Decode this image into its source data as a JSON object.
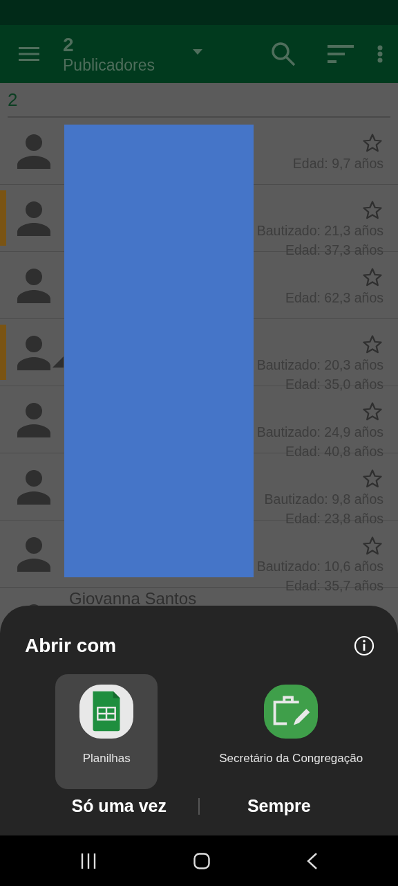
{
  "toolbar": {
    "count": "2",
    "title": "Publicadores"
  },
  "section": {
    "header": "2"
  },
  "rows": [
    {
      "name": "",
      "baptized": "",
      "age": "Edad: 9,7 años",
      "marked": false,
      "badge": false,
      "starred": false
    },
    {
      "name": "",
      "baptized": "Bautizado: 21,3 años",
      "age": "Edad: 37,3 años",
      "marked": true,
      "badge": false,
      "starred": false
    },
    {
      "name": "",
      "baptized": "",
      "age": "Edad: 62,3 años",
      "marked": false,
      "badge": false,
      "starred": false
    },
    {
      "name": "",
      "baptized": "Bautizado: 20,3 años",
      "age": "Edad: 35,0 años",
      "marked": true,
      "badge": true,
      "starred": false
    },
    {
      "name": "",
      "baptized": "Bautizado: 24,9 años",
      "age": "Edad: 40,8 años",
      "marked": false,
      "badge": false,
      "starred": false
    },
    {
      "name": "",
      "baptized": "Bautizado: 9,8 años",
      "age": "Edad: 23,8 años",
      "marked": false,
      "badge": false,
      "starred": false
    },
    {
      "name": "",
      "baptized": "Bautizado: 10,6 años",
      "age": "Edad: 35,7 años",
      "marked": false,
      "badge": false,
      "starred": false
    },
    {
      "name": "Giovanna Santos",
      "baptized": "",
      "age": ""
    }
  ],
  "sheet": {
    "title": "Abrir com",
    "apps": [
      {
        "kind": "sheets",
        "label": "Planilhas",
        "selected": true
      },
      {
        "kind": "briefcase",
        "label": "Secretário da Congregação",
        "selected": false
      }
    ],
    "buttons": [
      "Só uma vez",
      "Sempre"
    ]
  }
}
